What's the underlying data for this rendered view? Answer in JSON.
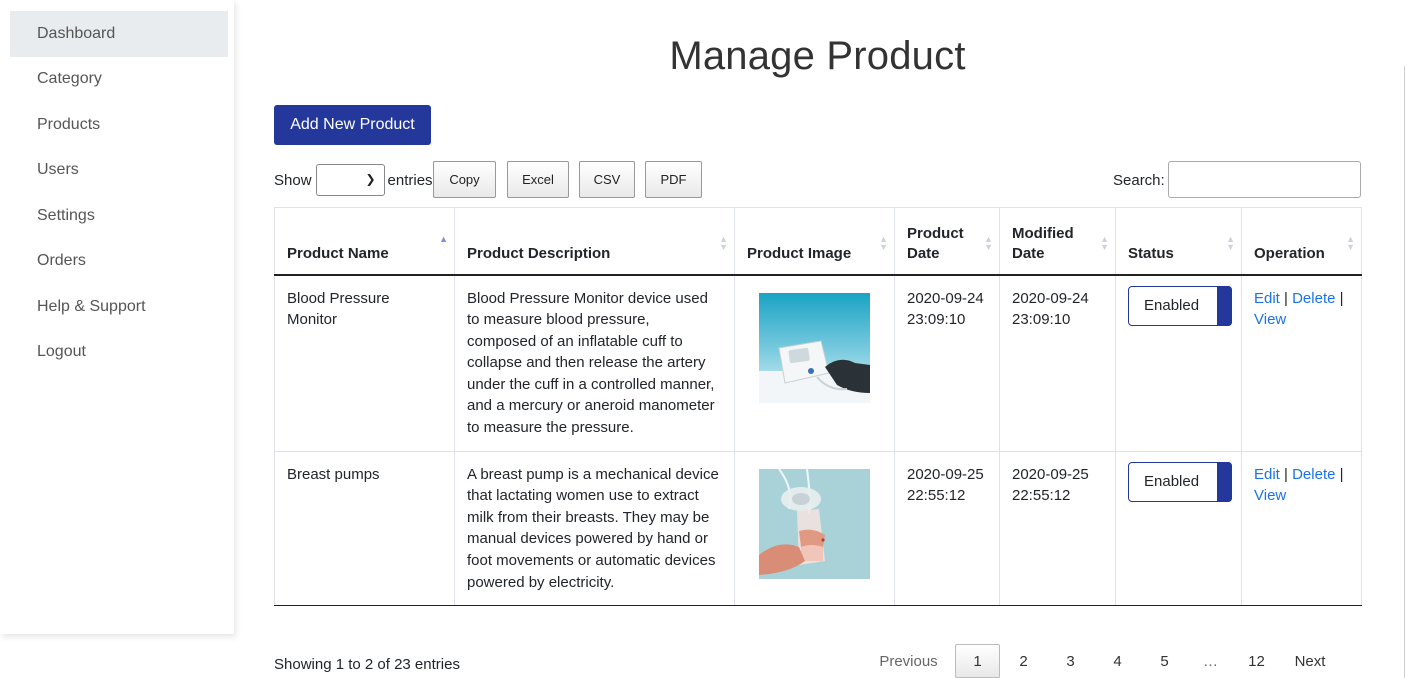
{
  "sidebar": {
    "items": [
      {
        "label": "Dashboard"
      },
      {
        "label": "Category"
      },
      {
        "label": "Products"
      },
      {
        "label": "Users"
      },
      {
        "label": "Settings"
      },
      {
        "label": "Orders"
      },
      {
        "label": "Help & Support"
      },
      {
        "label": "Logout"
      }
    ]
  },
  "page": {
    "title": "Manage Product",
    "add_button": "Add New Product"
  },
  "controls": {
    "show_label": "Show",
    "entries_label": "entries",
    "entries_value": "",
    "export_buttons": [
      "Copy",
      "Excel",
      "CSV",
      "PDF"
    ],
    "search_label": "Search:",
    "search_value": ""
  },
  "table": {
    "columns": [
      {
        "line1": "Product Name",
        "line2": ""
      },
      {
        "line1": "Product Description",
        "line2": ""
      },
      {
        "line1": "Product Image",
        "line2": ""
      },
      {
        "line1": "Product",
        "line2": "Date"
      },
      {
        "line1": "Modified",
        "line2": "Date"
      },
      {
        "line1": "Status",
        "line2": ""
      },
      {
        "line1": "Operation",
        "line2": ""
      }
    ],
    "rows": [
      {
        "name": "Blood Pressure Monitor",
        "description": "Blood Pressure Monitor device used to measure blood pressure, composed of an inflatable cuff to collapse and then release the artery under the cuff in a controlled manner, and a mercury or aneroid manometer to measure the pressure.",
        "product_date": "2020-09-24 23:09:10",
        "modified_date": "2020-09-24 23:09:10",
        "status": "Enabled",
        "ops": {
          "edit": "Edit",
          "sep1": " | ",
          "delete": "Delete",
          "sep2": " | ",
          "view": "View"
        }
      },
      {
        "name": "Breast pumps",
        "description": "A breast pump is a mechanical device that lactating women use to extract milk from their breasts. They may be manual devices powered by hand or foot movements or automatic devices powered by electricity.",
        "product_date": "2020-09-25 22:55:12",
        "modified_date": "2020-09-25 22:55:12",
        "status": "Enabled",
        "ops": {
          "edit": "Edit",
          "sep1": " | ",
          "delete": "Delete",
          "sep2": " | ",
          "view": "View"
        }
      }
    ]
  },
  "footer": {
    "info": "Showing 1 to 2 of 23 entries",
    "previous": "Previous",
    "pages": [
      "1",
      "2",
      "3",
      "4",
      "5"
    ],
    "ellipsis": "…",
    "last_page": "12",
    "next": "Next"
  }
}
